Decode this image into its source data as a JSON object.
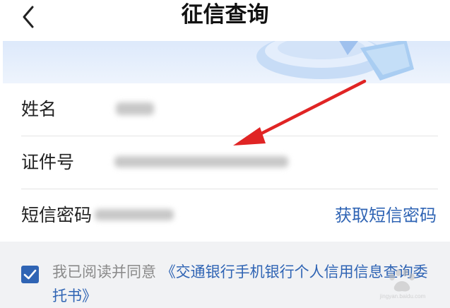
{
  "header": {
    "title": "征信查询"
  },
  "form": {
    "name_label": "姓名",
    "id_label": "证件号",
    "sms_label": "短信密码",
    "get_code_label": "获取短信密码"
  },
  "agreement": {
    "checked": true,
    "prefix": "我已阅读并同意",
    "link": "《交通银行手机银行个人信用信息查询委托书》"
  },
  "watermark": {
    "text": "jingyan.baidu.com"
  },
  "colors": {
    "accent": "#2f64b4",
    "annotation_arrow": "#e02424"
  }
}
